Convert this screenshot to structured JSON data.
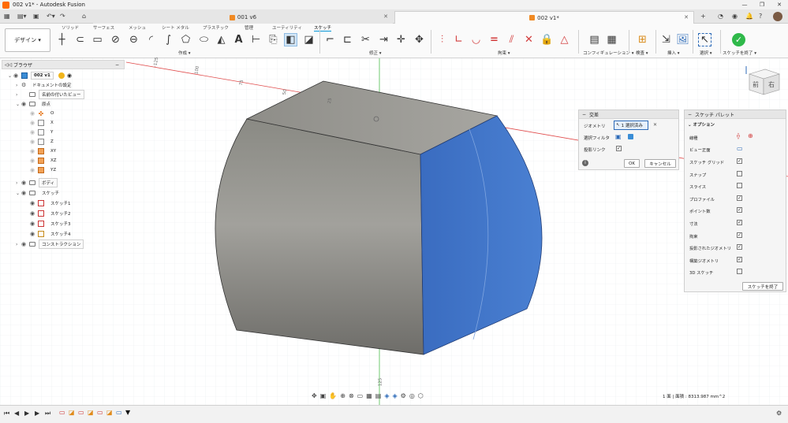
{
  "window": {
    "title": "002 v1* - Autodesk Fusion",
    "controls": [
      "—",
      "❐",
      "✕"
    ]
  },
  "tabs": [
    {
      "label": "001 v6"
    },
    {
      "label": "002 v1*"
    }
  ],
  "ribbon": {
    "workspace_button": "デザイン ▾",
    "tabs": [
      "ソリッド",
      "サーフェス",
      "メッシュ",
      "シート メタル",
      "プラスチック",
      "管理",
      "ユーティリティ",
      "スケッチ"
    ],
    "active_tab": "スケッチ",
    "groups": [
      "作成 ▾",
      "修正 ▾",
      "拘束 ▾",
      "コンフィギュレーション ▾",
      "検査 ▾",
      "挿入 ▾",
      "選択 ▾",
      "スケッチを終了 ▾"
    ]
  },
  "browser": {
    "title": "ブラウザ",
    "root": "002 v1",
    "items": [
      {
        "label": "ドキュメントの設定"
      },
      {
        "label": "名前の付いたビュー"
      },
      {
        "label": "原点"
      },
      {
        "label": "O"
      },
      {
        "label": "X"
      },
      {
        "label": "Y"
      },
      {
        "label": "Z"
      },
      {
        "label": "XY"
      },
      {
        "label": "XZ"
      },
      {
        "label": "YZ"
      },
      {
        "label": "ボディ"
      },
      {
        "label": "スケッチ"
      },
      {
        "label": "スケッチ1"
      },
      {
        "label": "スケッチ2"
      },
      {
        "label": "スケッチ3"
      },
      {
        "label": "スケッチ4"
      },
      {
        "label": "コンストラクション"
      }
    ]
  },
  "viewport": {
    "ruler_labels": [
      "-125",
      "100",
      "75",
      "50",
      "25",
      "125"
    ]
  },
  "intersect_dialog": {
    "title": "交差",
    "geometry_label": "ジオメトリ",
    "geometry_value": "1 選択済み",
    "filter_label": "選択フィルタ",
    "projection_link_label": "投影リンク",
    "projection_link_checked": true,
    "ok": "OK",
    "cancel": "キャンセル"
  },
  "sketch_palette": {
    "title": "スケッチ パレット",
    "section": "オプション",
    "linetype_label": "線種",
    "look_at_label": "ビュー正面",
    "options": [
      {
        "label": "スケッチ グリッド",
        "checked": true
      },
      {
        "label": "スナップ",
        "checked": false
      },
      {
        "label": "スライス",
        "checked": false
      },
      {
        "label": "プロファイル",
        "checked": true
      },
      {
        "label": "ポイント数",
        "checked": true
      },
      {
        "label": "寸法",
        "checked": true
      },
      {
        "label": "拘束",
        "checked": true
      },
      {
        "label": "投影されたジオメトリ",
        "checked": true
      },
      {
        "label": "構築ジオメトリ",
        "checked": true
      },
      {
        "label": "3D スケッチ",
        "checked": false
      }
    ],
    "finish_button": "スケッチを終了"
  },
  "view_cube": {
    "front": "前",
    "right": "右"
  },
  "status": "1 面 | 面積 : 8313.987 mm^2",
  "colors": {
    "accent": "#0696d7",
    "body_gray": "#8d8c85",
    "selected_face": "#3f73c4",
    "finish_green": "#2fb94a",
    "constraint_red": "#d23c3c"
  }
}
